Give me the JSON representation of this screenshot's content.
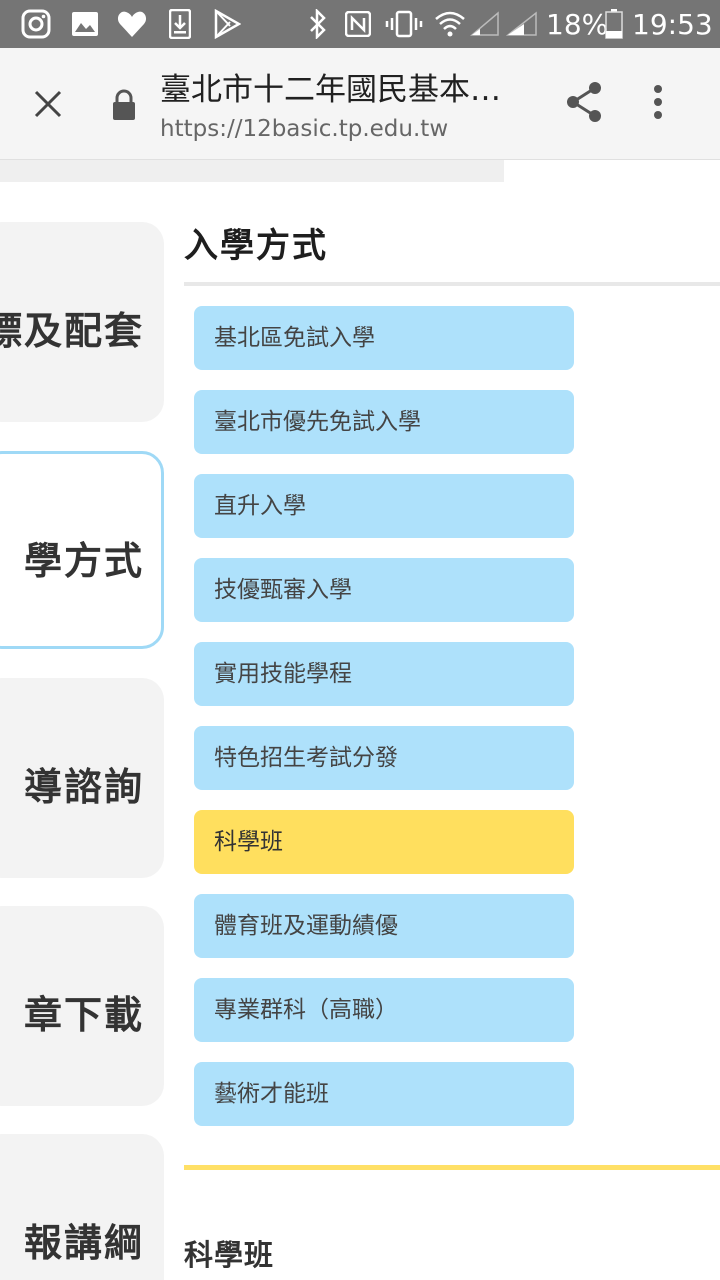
{
  "status_bar": {
    "battery": "18%",
    "time": "19:53",
    "icons": [
      "instagram-icon",
      "image-icon",
      "heart-icon",
      "download-icon",
      "play-store-icon",
      "bluetooth-icon",
      "nfc-icon",
      "vibrate-icon",
      "wifi-icon",
      "signal-icon",
      "signal-2-icon",
      "battery-icon"
    ]
  },
  "browser": {
    "page_title": "臺北市十二年國民基本…",
    "url": "https://12basic.tp.edu.tw"
  },
  "sidebar": {
    "items": [
      {
        "label": "標及配套"
      },
      {
        "label": "學方式"
      },
      {
        "label": "導諮詢"
      },
      {
        "label": "章下載"
      },
      {
        "label": "報講綱"
      }
    ]
  },
  "main": {
    "section_title": "入學方式",
    "items": [
      {
        "label": "基北區免試入學"
      },
      {
        "label": "臺北市優先免試入學"
      },
      {
        "label": "直升入學"
      },
      {
        "label": "技優甄審入學"
      },
      {
        "label": "實用技能學程"
      },
      {
        "label": "特色招生考試分發"
      },
      {
        "label": "科學班"
      },
      {
        "label": "體育班及運動績優"
      },
      {
        "label": "專業群科（高職）"
      },
      {
        "label": "藝術才能班"
      }
    ],
    "selected_label": "科學班",
    "bottom_title": "科學班"
  },
  "colors": {
    "item_bg": "#aee1fb",
    "selected_bg": "#ffdf5e",
    "active_border": "#9fd9f6",
    "status_bar": "#757575"
  }
}
